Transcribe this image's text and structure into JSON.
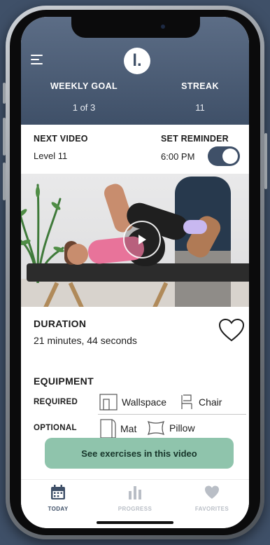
{
  "header": {
    "logo_text": "l.",
    "weekly_goal": {
      "label": "WEEKLY GOAL",
      "value": "1 of 3"
    },
    "streak": {
      "label": "STREAK",
      "value": "11"
    }
  },
  "next_video": {
    "label": "NEXT VIDEO",
    "level": "Level 11",
    "reminder_label": "SET REMINDER",
    "reminder_time": "6:00 PM",
    "reminder_on": true
  },
  "details": {
    "duration_label": "DURATION",
    "duration_value": "21 minutes, 44 seconds",
    "equipment_label": "EQUIPMENT",
    "required_label": "REQUIRED",
    "required_items": [
      "Wallspace",
      "Chair"
    ],
    "optional_label": "OPTIONAL",
    "optional_items": [
      "Mat",
      "Pillow"
    ],
    "cta_label": "See exercises in this video"
  },
  "tabs": [
    {
      "label": "TODAY",
      "icon": "calendar-icon",
      "active": true
    },
    {
      "label": "PROGRESS",
      "icon": "bar-chart-icon",
      "active": false
    },
    {
      "label": "FAVORITES",
      "icon": "heart-icon",
      "active": false
    }
  ],
  "colors": {
    "primary": "#3f5068",
    "accent_green": "#8fc4ac",
    "inactive_tab": "#b9bec6"
  }
}
